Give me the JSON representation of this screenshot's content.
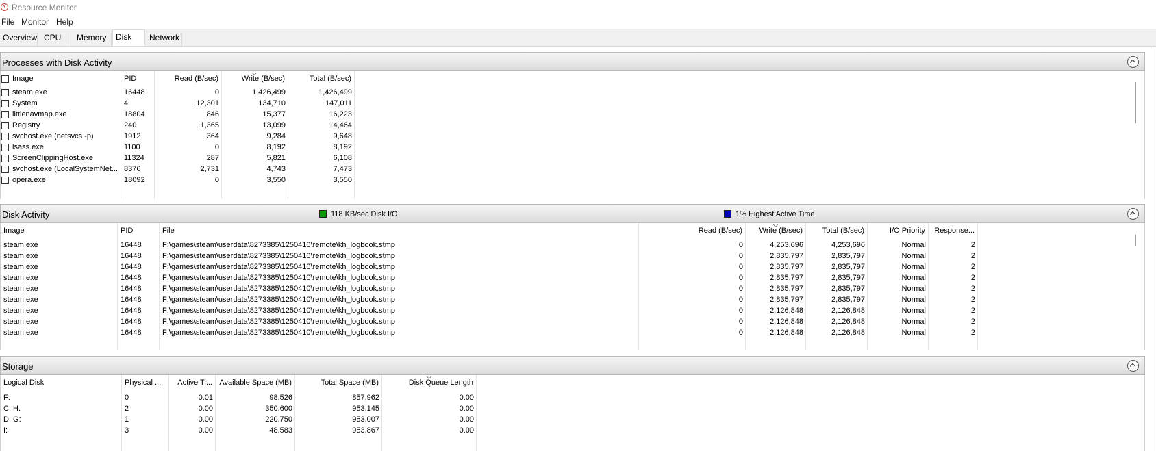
{
  "window": {
    "title": "Resource Monitor"
  },
  "menu": [
    "File",
    "Monitor",
    "Help"
  ],
  "tabs": [
    {
      "label": "Overview",
      "active": false
    },
    {
      "label": "CPU",
      "active": false
    },
    {
      "label": "Memory",
      "active": false
    },
    {
      "label": "Disk",
      "active": true
    },
    {
      "label": "Network",
      "active": false
    }
  ],
  "processes": {
    "title": "Processes with Disk Activity",
    "columns": [
      "Image",
      "PID",
      "Read (B/sec)",
      "Write (B/sec)",
      "Total (B/sec)"
    ],
    "rows": [
      [
        "steam.exe",
        "16448",
        "0",
        "1,426,499",
        "1,426,499"
      ],
      [
        "System",
        "4",
        "12,301",
        "134,710",
        "147,011"
      ],
      [
        "littlenavmap.exe",
        "18804",
        "846",
        "15,377",
        "16,223"
      ],
      [
        "Registry",
        "240",
        "1,365",
        "13,099",
        "14,464"
      ],
      [
        "svchost.exe (netsvcs -p)",
        "1912",
        "364",
        "9,284",
        "9,648"
      ],
      [
        "lsass.exe",
        "1100",
        "0",
        "8,192",
        "8,192"
      ],
      [
        "ScreenClippingHost.exe",
        "11324",
        "287",
        "5,821",
        "6,108"
      ],
      [
        "svchost.exe (LocalSystemNet...",
        "8376",
        "2,731",
        "4,743",
        "7,473"
      ],
      [
        "opera.exe",
        "18092",
        "0",
        "3,550",
        "3,550"
      ]
    ]
  },
  "disk_activity": {
    "title": "Disk Activity",
    "legend_io": "118 KB/sec Disk I/O",
    "legend_active": "1% Highest Active Time",
    "io_color": "#00a000",
    "active_color": "#0000c0",
    "columns": [
      "Image",
      "PID",
      "File",
      "Read (B/sec)",
      "Write (B/sec)",
      "Total (B/sec)",
      "I/O Priority",
      "Response..."
    ],
    "rows": [
      [
        "steam.exe",
        "16448",
        "F:\\games\\steam\\userdata\\8273385\\1250410\\remote\\kh_logbook.stmp",
        "0",
        "4,253,696",
        "4,253,696",
        "Normal",
        "2"
      ],
      [
        "steam.exe",
        "16448",
        "F:\\games\\steam\\userdata\\8273385\\1250410\\remote\\kh_logbook.stmp",
        "0",
        "2,835,797",
        "2,835,797",
        "Normal",
        "2"
      ],
      [
        "steam.exe",
        "16448",
        "F:\\games\\steam\\userdata\\8273385\\1250410\\remote\\kh_logbook.stmp",
        "0",
        "2,835,797",
        "2,835,797",
        "Normal",
        "2"
      ],
      [
        "steam.exe",
        "16448",
        "F:\\games\\steam\\userdata\\8273385\\1250410\\remote\\kh_logbook.stmp",
        "0",
        "2,835,797",
        "2,835,797",
        "Normal",
        "2"
      ],
      [
        "steam.exe",
        "16448",
        "F:\\games\\steam\\userdata\\8273385\\1250410\\remote\\kh_logbook.stmp",
        "0",
        "2,835,797",
        "2,835,797",
        "Normal",
        "2"
      ],
      [
        "steam.exe",
        "16448",
        "F:\\games\\steam\\userdata\\8273385\\1250410\\remote\\kh_logbook.stmp",
        "0",
        "2,835,797",
        "2,835,797",
        "Normal",
        "2"
      ],
      [
        "steam.exe",
        "16448",
        "F:\\games\\steam\\userdata\\8273385\\1250410\\remote\\kh_logbook.stmp",
        "0",
        "2,126,848",
        "2,126,848",
        "Normal",
        "2"
      ],
      [
        "steam.exe",
        "16448",
        "F:\\games\\steam\\userdata\\8273385\\1250410\\remote\\kh_logbook.stmp",
        "0",
        "2,126,848",
        "2,126,848",
        "Normal",
        "2"
      ],
      [
        "steam.exe",
        "16448",
        "F:\\games\\steam\\userdata\\8273385\\1250410\\remote\\kh_logbook.stmp",
        "0",
        "2,126,848",
        "2,126,848",
        "Normal",
        "2"
      ]
    ]
  },
  "storage": {
    "title": "Storage",
    "columns": [
      "Logical Disk",
      "Physical ...",
      "Active Ti...",
      "Available Space (MB)",
      "Total Space (MB)",
      "Disk Queue Length"
    ],
    "rows": [
      [
        "F:",
        "0",
        "0.01",
        "98,526",
        "857,962",
        "0.00"
      ],
      [
        "C: H:",
        "2",
        "0.00",
        "350,600",
        "953,145",
        "0.00"
      ],
      [
        "D: G:",
        "1",
        "0.00",
        "220,750",
        "953,007",
        "0.00"
      ],
      [
        "I:",
        "3",
        "0.00",
        "48,583",
        "953,867",
        "0.00"
      ]
    ]
  }
}
